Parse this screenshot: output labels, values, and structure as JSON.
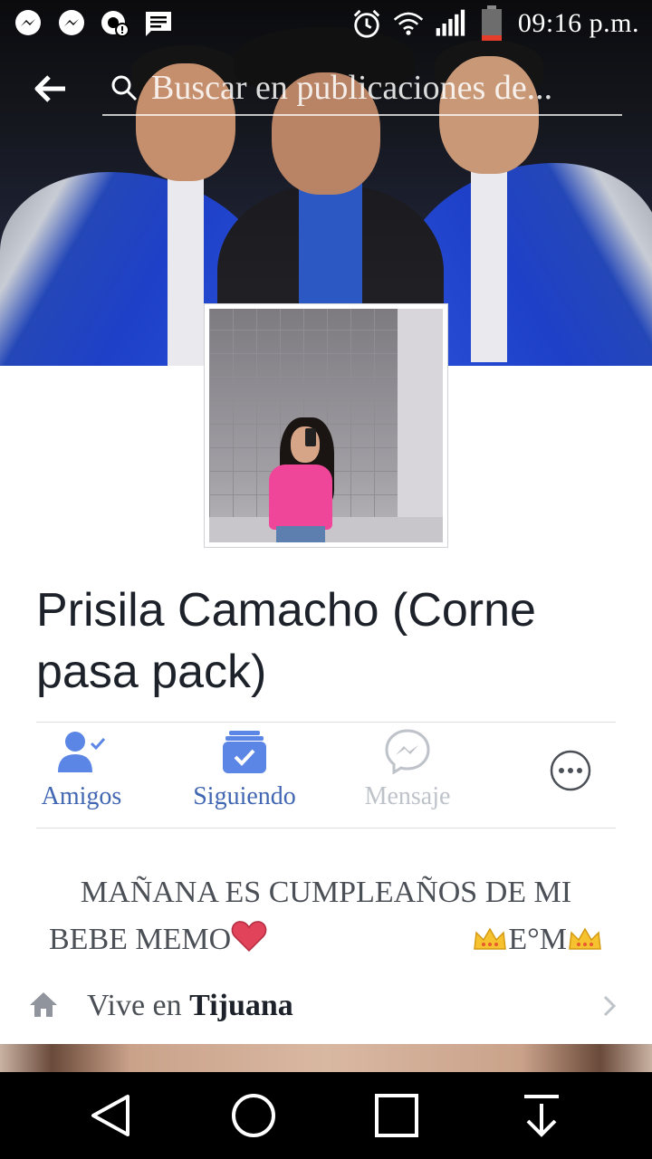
{
  "status_bar": {
    "time": "09:16 p.m."
  },
  "search": {
    "placeholder": "Buscar en publicaciones de..."
  },
  "profile": {
    "name": "Prisila Camacho (Corne pasa pack)"
  },
  "actions": {
    "friends_label": "Amigos",
    "following_label": "Siguiendo",
    "message_label": "Mensaje"
  },
  "bio": {
    "line1": "MAÑANA ES CUMPLEAÑOS DE MI",
    "line2_left": "BEBE MEMO",
    "line2_right": "E°M"
  },
  "lives_in": {
    "prefix": "Vive en",
    "city": "Tijuana"
  },
  "colors": {
    "accent": "#4267b2",
    "accent_light": "#5b86e5",
    "muted_icon": "#bec2c9",
    "text_dark": "#1d2129",
    "text_gray": "#4b4f56"
  },
  "icons": {
    "status_left": [
      "messenger-icon",
      "messenger-icon",
      "chat-heads-icon",
      "message-icon"
    ],
    "status_right": [
      "alarm-icon",
      "wifi-icon",
      "signal-icon",
      "battery-icon"
    ]
  }
}
